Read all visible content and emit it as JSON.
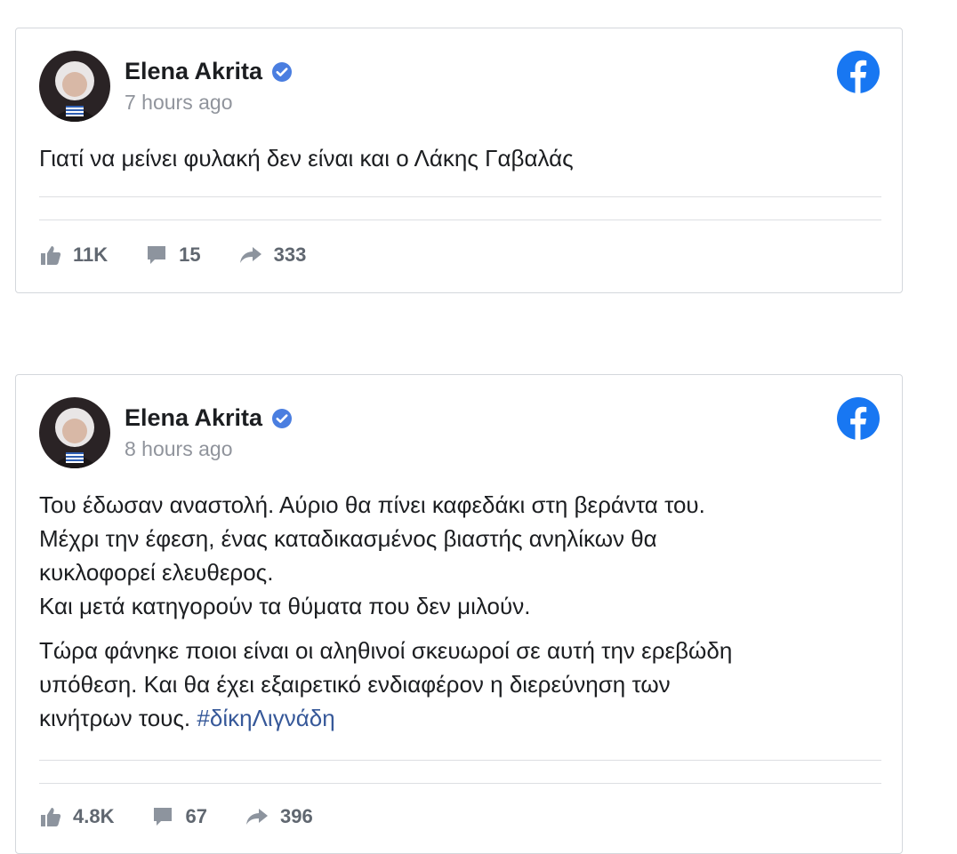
{
  "posts": [
    {
      "author": "Elena Akrita",
      "time": "7 hours ago",
      "paragraphs": [
        [
          "Γιατί να μείνει φυλακή δεν είναι και ο Λάκης Γαβαλάς"
        ]
      ],
      "likes": "11K",
      "comments": "15",
      "shares": "333"
    },
    {
      "author": "Elena Akrita",
      "time": "8 hours ago",
      "paragraphs": [
        [
          "Του έδωσαν αναστολή. Αύριο θα πίνει καφεδάκι στη βεράντα του.",
          "Μέχρι την έφεση, ένας καταδικασμένος βιαστής ανηλίκων θα",
          "κυκλοφορεί ελευθερος.",
          "Και μετά κατηγορούν τα θύματα που δεν μιλούν."
        ],
        [
          "Τώρα φάνηκε ποιοι είναι οι αληθινοί σκευωροί σε αυτή την ερεβώδη",
          "υπόθεση. Και θα έχει εξαιρετικό ενδιαφέρον η διερεύνηση των",
          "κινήτρων τους."
        ]
      ],
      "hashtag": "#δίκηΛιγνάδη",
      "likes": "4.8K",
      "comments": "67",
      "shares": "396"
    }
  ],
  "icons": {
    "verified": "verified-badge-icon",
    "platform": "facebook-logo-icon",
    "like": "thumbs-up-icon",
    "comment": "comment-bubble-icon",
    "share": "share-arrow-icon"
  },
  "colors": {
    "facebook_blue": "#1877f2",
    "verified_blue": "#4a7ee0",
    "hashtag": "#365899",
    "muted_text": "#90949c",
    "action_text": "#606770"
  }
}
